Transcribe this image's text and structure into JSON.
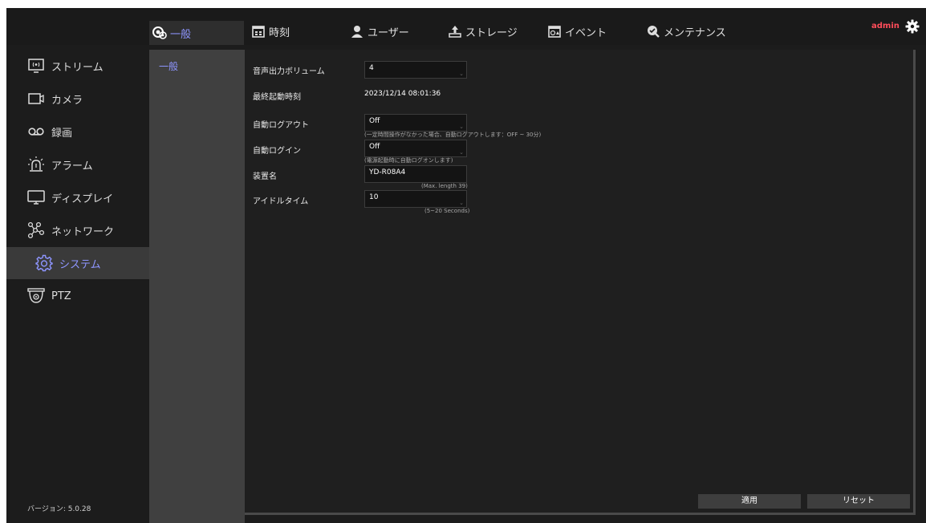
{
  "user": {
    "name": "admin"
  },
  "top_tabs": [
    {
      "label": "一般",
      "icon": "general-icon",
      "active": true
    },
    {
      "label": "時刻",
      "icon": "calendar-icon"
    },
    {
      "label": "ユーザー",
      "icon": "user-icon"
    },
    {
      "label": "ストレージ",
      "icon": "storage-icon"
    },
    {
      "label": "イベント",
      "icon": "event-icon"
    },
    {
      "label": "メンテナンス",
      "icon": "maintenance-icon"
    }
  ],
  "sidebar": {
    "items": [
      {
        "label": "ストリーム",
        "icon": "stream-icon"
      },
      {
        "label": "カメラ",
        "icon": "camera-icon"
      },
      {
        "label": "録画",
        "icon": "record-icon"
      },
      {
        "label": "アラーム",
        "icon": "alarm-icon"
      },
      {
        "label": "ディスプレイ",
        "icon": "display-icon"
      },
      {
        "label": "ネットワーク",
        "icon": "network-icon"
      },
      {
        "label": "システム",
        "icon": "system-gear-icon",
        "active": true
      },
      {
        "label": "PTZ",
        "icon": "ptz-icon"
      }
    ],
    "version": "バージョン: 5.0.28"
  },
  "submenu": {
    "items": [
      {
        "label": "一般",
        "active": true
      }
    ]
  },
  "form": {
    "volume": {
      "label": "音声出力ボリューム",
      "value": "4"
    },
    "last_boot": {
      "label": "最終起動時刻",
      "value": "2023/12/14 08:01:36"
    },
    "auto_logout": {
      "label": "自動ログアウト",
      "value": "Off",
      "hint": "(一定時間操作がなかった場合、自動ログアウトします：OFF ~ 30分)"
    },
    "auto_login": {
      "label": "自動ログイン",
      "value": "Off",
      "hint": "(電源起動時に自動ログオンします)"
    },
    "device_name": {
      "label": "装置名",
      "value": "YD-R08A4",
      "hint": "(Max. length 39)"
    },
    "idle_time": {
      "label": "アイドルタイム",
      "value": "10",
      "hint": "(5~20 Seconds)"
    }
  },
  "buttons": {
    "apply": "適用",
    "reset": "リセット"
  },
  "colors": {
    "accent": "#8e95ff",
    "admin": "#ff4d5a",
    "background": "#1c1c1c"
  }
}
